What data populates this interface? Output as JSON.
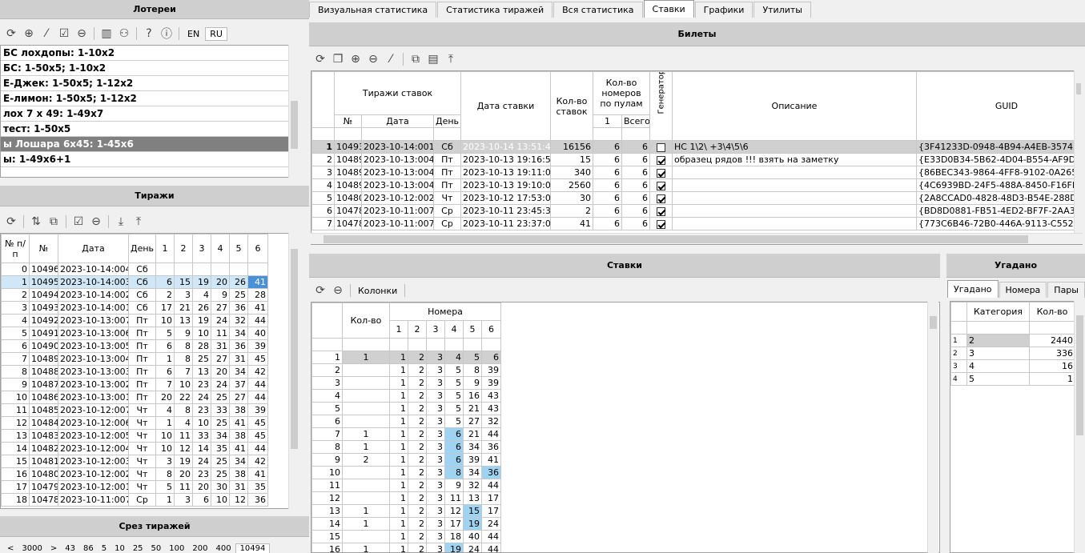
{
  "lotteries": {
    "title": "Лотереи",
    "lang_en": "EN",
    "lang_ru": "RU",
    "items": [
      "БС лохдопы: 1-10x2",
      "БС: 1-50x5; 1-10x2",
      "Е-Джек: 1-50x5; 1-12x2",
      "Е-лимон: 1-50x5; 1-12x2",
      "лох 7 x 49: 1-49x7",
      "тест: 1-50x5",
      "ы Лошара 6x45: 1-45x6",
      "ы: 1-49x6+1"
    ]
  },
  "draws": {
    "title": "Тиражи",
    "headers": [
      "№ п/п",
      "№",
      "Дата",
      "День",
      "1",
      "2",
      "3",
      "4",
      "5",
      "6"
    ],
    "rows": [
      [
        "0",
        "10496",
        "2023-10-14:004",
        "Сб",
        "",
        "",
        "",
        "",
        "",
        ""
      ],
      [
        "1",
        "10495",
        "2023-10-14:003",
        "Сб",
        "6",
        "15",
        "19",
        "20",
        "26",
        "41"
      ],
      [
        "2",
        "10494",
        "2023-10-14:002",
        "Сб",
        "2",
        "3",
        "4",
        "9",
        "25",
        "28"
      ],
      [
        "3",
        "10493",
        "2023-10-14:001",
        "Сб",
        "17",
        "21",
        "26",
        "27",
        "36",
        "41"
      ],
      [
        "4",
        "10492",
        "2023-10-13:007",
        "Пт",
        "10",
        "13",
        "19",
        "24",
        "32",
        "44"
      ],
      [
        "5",
        "10491",
        "2023-10-13:006",
        "Пт",
        "5",
        "9",
        "10",
        "11",
        "34",
        "40"
      ],
      [
        "6",
        "10490",
        "2023-10-13:005",
        "Пт",
        "6",
        "8",
        "28",
        "31",
        "36",
        "39"
      ],
      [
        "7",
        "10489",
        "2023-10-13:004",
        "Пт",
        "1",
        "8",
        "25",
        "27",
        "31",
        "45"
      ],
      [
        "8",
        "10488",
        "2023-10-13:003",
        "Пт",
        "6",
        "7",
        "13",
        "20",
        "34",
        "42"
      ],
      [
        "9",
        "10487",
        "2023-10-13:002",
        "Пт",
        "7",
        "10",
        "23",
        "24",
        "37",
        "44"
      ],
      [
        "10",
        "10486",
        "2023-10-13:001",
        "Пт",
        "20",
        "22",
        "24",
        "25",
        "27",
        "44"
      ],
      [
        "11",
        "10485",
        "2023-10-12:007",
        "Чт",
        "4",
        "8",
        "23",
        "33",
        "38",
        "39"
      ],
      [
        "12",
        "10484",
        "2023-10-12:006",
        "Чт",
        "1",
        "4",
        "10",
        "25",
        "41",
        "45"
      ],
      [
        "13",
        "10483",
        "2023-10-12:005",
        "Чт",
        "10",
        "11",
        "33",
        "34",
        "38",
        "45"
      ],
      [
        "14",
        "10482",
        "2023-10-12:004",
        "Чт",
        "10",
        "12",
        "14",
        "35",
        "41",
        "44"
      ],
      [
        "15",
        "10481",
        "2023-10-12:003",
        "Чт",
        "3",
        "19",
        "24",
        "25",
        "34",
        "42"
      ],
      [
        "16",
        "10480",
        "2023-10-12:002",
        "Чт",
        "8",
        "20",
        "23",
        "25",
        "38",
        "41"
      ],
      [
        "17",
        "10479",
        "2023-10-12:001",
        "Чт",
        "5",
        "11",
        "20",
        "30",
        "31",
        "35"
      ],
      [
        "18",
        "10478",
        "2023-10-11:007",
        "Ср",
        "1",
        "3",
        "6",
        "10",
        "12",
        "36"
      ]
    ]
  },
  "slice": {
    "title": "Срез тиражей",
    "buttons": [
      "<",
      "3000",
      ">",
      "43",
      "86",
      "5",
      "10",
      "25",
      "50",
      "100",
      "200",
      "400",
      "10494"
    ]
  },
  "tabs": [
    "Визуальная статистика",
    "Статистика тиражей",
    "Вся статистика",
    "Ставки",
    "Графики",
    "Утилиты"
  ],
  "tickets": {
    "title": "Билеты",
    "h_draws": "Тиражи ставок",
    "h_no": "№",
    "h_date": "Дата",
    "h_day": "День",
    "h_betdate": "Дата ставки",
    "h_count": "Кол-во ставок",
    "h_pool": "Кол-во номеров по пулам",
    "h_p1": "1",
    "h_all": "Всего",
    "h_gen": "Генератор",
    "h_desc": "Описание",
    "h_guid": "GUID",
    "rows": [
      [
        "1",
        "10493",
        "2023-10-14:001",
        "Сб",
        "2023-10-14 13:51:45",
        "16156",
        "6",
        "6",
        false,
        "НС 1\\2\\ +3\\4\\5\\6",
        "{3F41233D-0948-4B94-A4EB-35745725F"
      ],
      [
        "2",
        "10489",
        "2023-10-13:004",
        "Пт",
        "2023-10-13 19:16:59",
        "15",
        "6",
        "6",
        true,
        "образец рядов !!! взять на заметку",
        "{E33D0B34-5B62-4D04-B554-AF9DADCD"
      ],
      [
        "3",
        "10489",
        "2023-10-13:004",
        "Пт",
        "2023-10-13 19:11:09",
        "340",
        "6",
        "6",
        true,
        "",
        "{86BEC343-9864-4FF8-9102-0A265A3D"
      ],
      [
        "4",
        "10489",
        "2023-10-13:004",
        "Пт",
        "2023-10-13 19:10:05",
        "2560",
        "6",
        "6",
        true,
        "",
        "{4C6939BD-24F5-488A-8450-F16FEAC4"
      ],
      [
        "5",
        "10480",
        "2023-10-12:002",
        "Чт",
        "2023-10-12 17:53:04",
        "30",
        "6",
        "6",
        true,
        "",
        "{2A8CCAD0-4828-48D3-B54E-288DABFA"
      ],
      [
        "6",
        "10478",
        "2023-10-11:007",
        "Ср",
        "2023-10-11 23:45:33",
        "2",
        "6",
        "6",
        true,
        "",
        "{BD8D0881-FB51-4ED2-BF7F-2AA3A107"
      ],
      [
        "7",
        "10478",
        "2023-10-11:007",
        "Ср",
        "2023-10-11 23:37:02",
        "41",
        "6",
        "6",
        true,
        "",
        "{773C6B46-72B0-446A-9113-C5523EB9E"
      ]
    ]
  },
  "bets": {
    "title": "Ставки",
    "columns_btn": "Колонки",
    "h_count": "Кол-во",
    "h_nums": "Номера",
    "nums": [
      "1",
      "2",
      "3",
      "4",
      "5",
      "6"
    ],
    "rows": [
      [
        "1",
        "1",
        "1",
        "2",
        "3",
        "4",
        "5",
        "6"
      ],
      [
        "2",
        "",
        "1",
        "2",
        "3",
        "5",
        "8",
        "39"
      ],
      [
        "3",
        "",
        "1",
        "2",
        "3",
        "5",
        "9",
        "39"
      ],
      [
        "4",
        "",
        "1",
        "2",
        "3",
        "5",
        "16",
        "43"
      ],
      [
        "5",
        "",
        "1",
        "2",
        "3",
        "5",
        "21",
        "43"
      ],
      [
        "6",
        "",
        "1",
        "2",
        "3",
        "5",
        "27",
        "32"
      ],
      [
        "7",
        "1",
        "1",
        "2",
        "3",
        "6",
        "21",
        "44"
      ],
      [
        "8",
        "1",
        "1",
        "2",
        "3",
        "6",
        "34",
        "36"
      ],
      [
        "9",
        "2",
        "1",
        "2",
        "3",
        "6",
        "39",
        "41"
      ],
      [
        "10",
        "",
        "1",
        "2",
        "3",
        "8",
        "34",
        "36"
      ],
      [
        "11",
        "",
        "1",
        "2",
        "3",
        "9",
        "32",
        "44"
      ],
      [
        "12",
        "",
        "1",
        "2",
        "3",
        "11",
        "13",
        "17"
      ],
      [
        "13",
        "1",
        "1",
        "2",
        "3",
        "12",
        "15",
        "17"
      ],
      [
        "14",
        "1",
        "1",
        "2",
        "3",
        "17",
        "19",
        "24"
      ],
      [
        "15",
        "",
        "1",
        "2",
        "3",
        "18",
        "40",
        "44"
      ],
      [
        "16",
        "1",
        "1",
        "2",
        "3",
        "19",
        "24",
        "44"
      ]
    ]
  },
  "guessed": {
    "title": "Угадано",
    "tabs": [
      "Угадано",
      "Номера",
      "Пары"
    ],
    "h_cat": "Категория",
    "h_count": "Кол-во",
    "rows": [
      [
        "1",
        "2",
        "2440"
      ],
      [
        "2",
        "3",
        "336"
      ],
      [
        "3",
        "4",
        "16"
      ],
      [
        "4",
        "5",
        "1"
      ]
    ]
  }
}
